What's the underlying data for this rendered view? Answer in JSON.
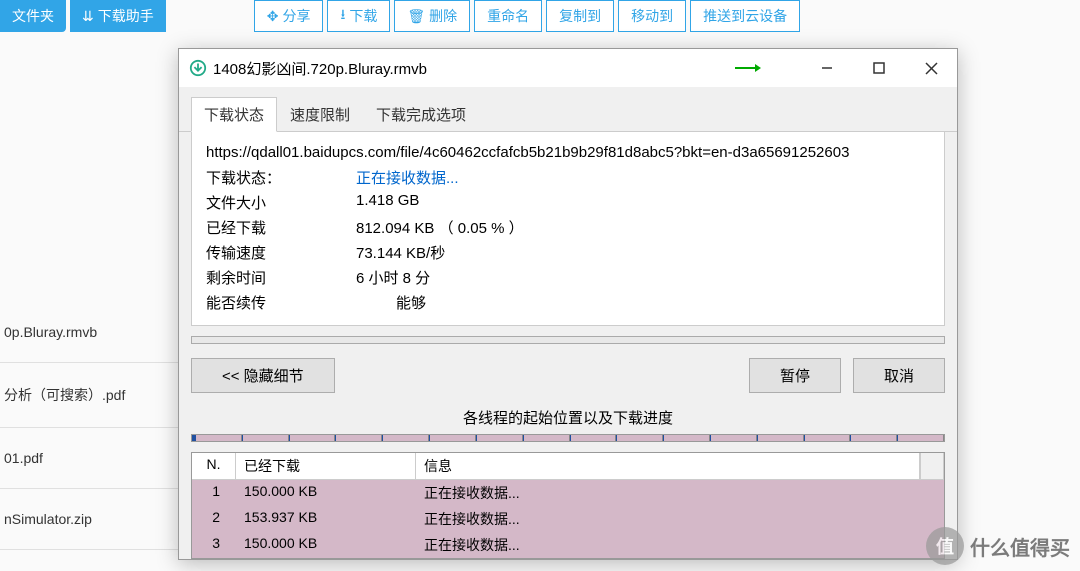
{
  "bg_toolbar": {
    "folder": "文件夹",
    "assistant": "下载助手",
    "share": "分享",
    "download": "下载",
    "delete": "删除",
    "rename": "重命名",
    "copy_to": "复制到",
    "move_to": "移动到",
    "push": "推送到云设备"
  },
  "bg_files": {
    "f1": "0p.Bluray.rmvb",
    "f2": "分析（可搜索）.pdf",
    "f3": "01.pdf",
    "f4": "nSimulator.zip"
  },
  "dialog": {
    "title": "1408幻影凶间.720p.Bluray.rmvb",
    "tabs": {
      "status": "下载状态",
      "speed": "速度限制",
      "complete": "下载完成选项"
    },
    "url": "https://qdall01.baidupcs.com/file/4c60462ccfafcb5b21b9b29f81d8abc5?bkt=en-d3a65691252603",
    "labels": {
      "status": "下载状态：",
      "filesize": "文件大小",
      "downloaded": "已经下载",
      "speed": "传输速度",
      "remaining": "剩余时间",
      "resumable": "能否续传"
    },
    "values": {
      "status": "正在接收数据...",
      "filesize": "1.418   GB",
      "downloaded": "812.094   KB  （ 0.05 % ）",
      "speed": "73.144   KB/秒",
      "remaining": "6 小时 8 分",
      "resumable": "能够"
    },
    "buttons": {
      "hide": "<<  隐藏细节",
      "pause": "暂停",
      "cancel": "取消"
    },
    "threads_label": "各线程的起始位置以及下载进度",
    "table": {
      "headers": {
        "n": "N.",
        "downloaded": "已经下载",
        "info": "信息"
      },
      "rows": [
        {
          "n": "1",
          "dl": "150.000   KB",
          "info": "正在接收数据..."
        },
        {
          "n": "2",
          "dl": "153.937   KB",
          "info": "正在接收数据..."
        },
        {
          "n": "3",
          "dl": "150.000   KB",
          "info": "正在接收数据..."
        }
      ]
    }
  },
  "watermark": {
    "glyph": "值",
    "text": "什么值得买"
  }
}
